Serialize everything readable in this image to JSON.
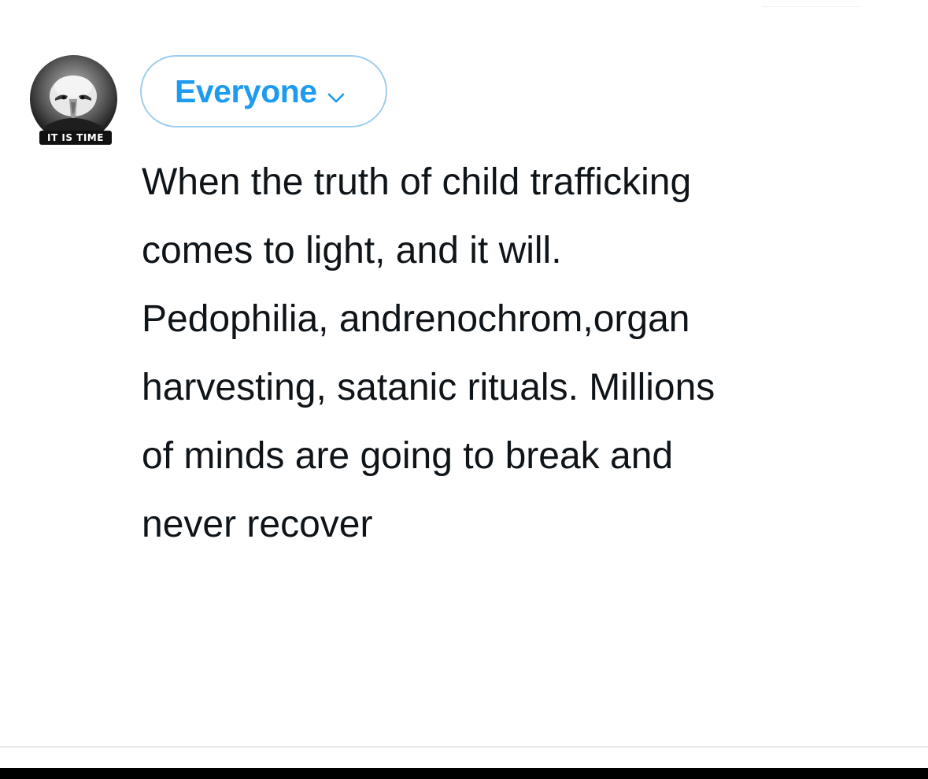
{
  "composer": {
    "avatar_icon": "eagle-avatar-icon",
    "avatar_caption": "IT IS TIME",
    "audience_label": "Everyone",
    "audience_chevron_icon": "chevron-down-icon",
    "accent_color": "#1d9bf0",
    "tweet_text": "When the truth of child trafficking\ncomes to light, and it will.\nPedophilia, andrenochrom,organ\nharvesting, satanic rituals. Millions\nof minds are going to break and\nnever recover"
  }
}
